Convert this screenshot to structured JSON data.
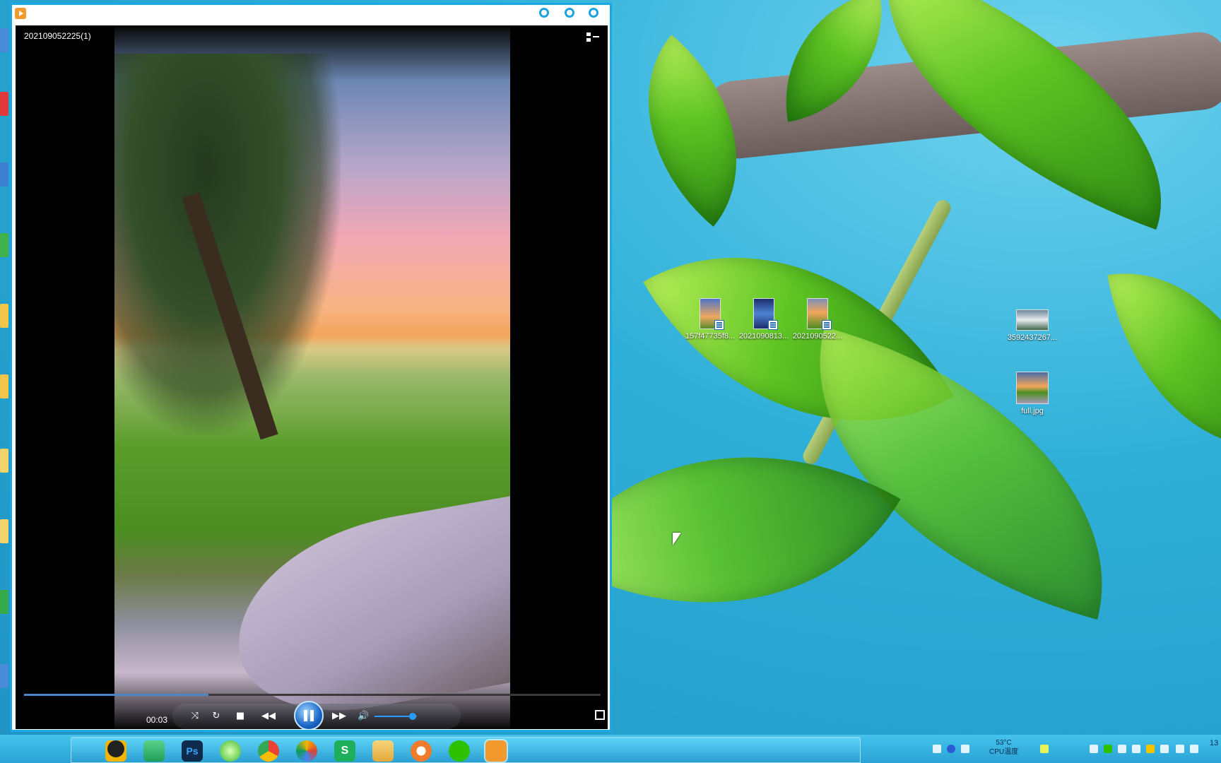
{
  "player": {
    "filename": "202109052225(1)",
    "elapsed": "00:03",
    "progress": 0.32,
    "volume": 0.9
  },
  "desktop_icons": [
    {
      "label": "157f47735f8..."
    },
    {
      "label": "2021090813..."
    },
    {
      "label": "2021090522..."
    },
    {
      "label": "3592437267..."
    },
    {
      "label": "full.jpg"
    }
  ],
  "tray": {
    "cpu_temp": "53°C",
    "cpu_label": "CPU温度",
    "clock_partial": "13"
  },
  "taskbar_apps": [
    "qq-icon",
    "video-app-icon",
    "photoshop-icon",
    "browser-green-icon",
    "chrome-icon",
    "photos-icon",
    "wps-icon",
    "file-explorer-icon",
    "fox-app-icon",
    "wechat-icon",
    "media-player-icon"
  ]
}
